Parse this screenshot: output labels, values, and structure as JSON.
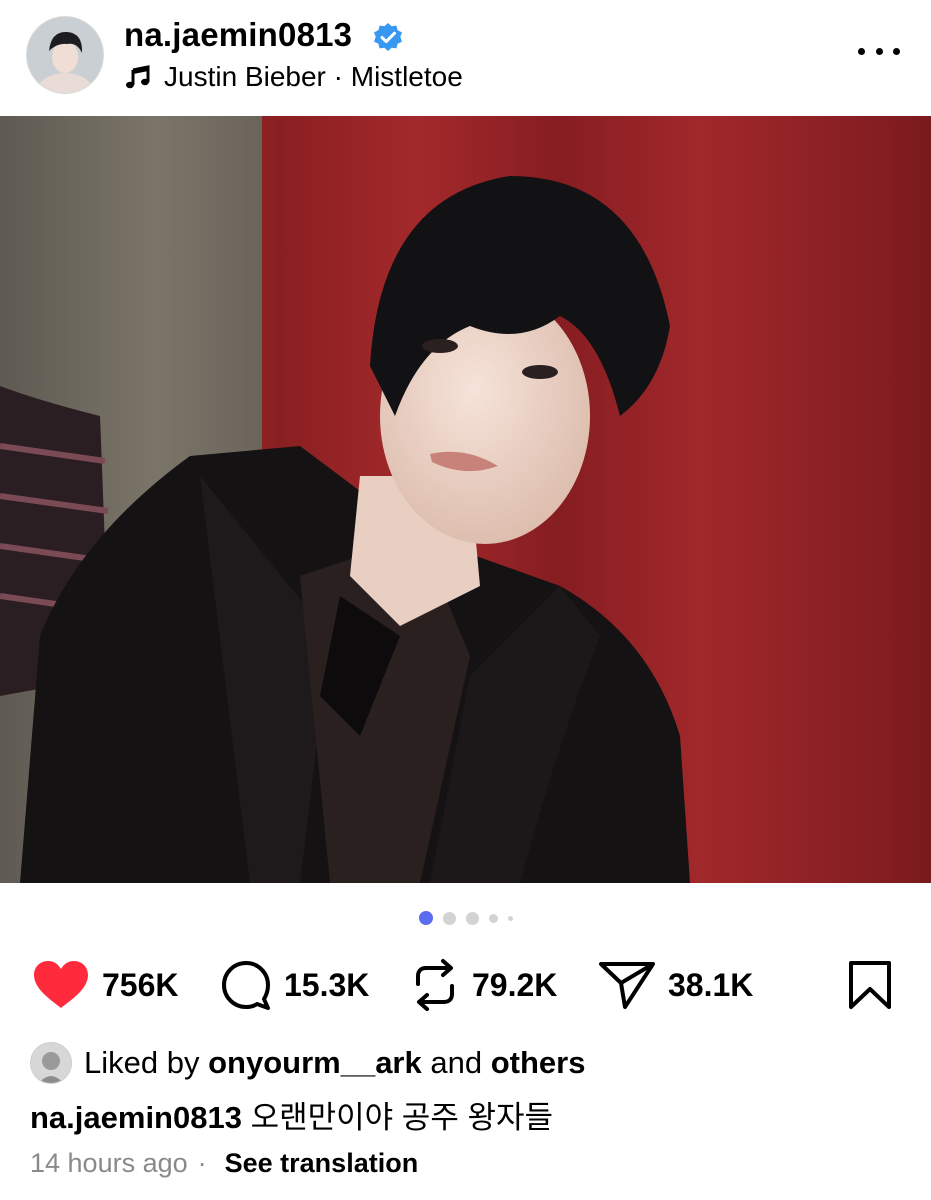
{
  "post": {
    "username": "na.jaemin0813",
    "music": "Justin Bieber · Mistletoe",
    "carousel": {
      "count": 5,
      "active_index": 0
    }
  },
  "actions": {
    "likes": "756K",
    "comments": "15.3K",
    "reposts": "79.2K",
    "shares": "38.1K"
  },
  "liked_by": {
    "prefix": "Liked by",
    "user": "onyourm__ark",
    "conjunction": "and",
    "others": "others"
  },
  "caption": {
    "username": "na.jaemin0813",
    "text": "오랜만이야 공주 왕자들"
  },
  "meta": {
    "time": "14 hours ago",
    "separator": "·",
    "see_translation": "See translation"
  },
  "colors": {
    "like": "#ff2b3d",
    "verified": "#3897f0",
    "active_dot": "#5b6cf0"
  },
  "icons": [
    "verified-badge-icon",
    "music-note-icon",
    "more-options-icon",
    "sound-on-icon",
    "heart-icon",
    "comment-icon",
    "repost-icon",
    "share-icon",
    "bookmark-icon"
  ]
}
